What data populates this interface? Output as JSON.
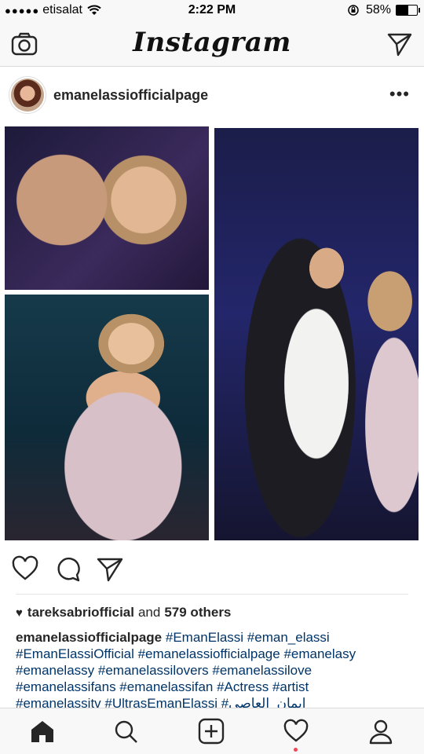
{
  "status": {
    "carrier": "etisalat",
    "time": "2:22 PM",
    "battery": "58%",
    "battery_level": 0.58
  },
  "app": {
    "title": "Instagram"
  },
  "post": {
    "username": "emanelassiofficialpage",
    "likes": {
      "liker": "tareksabriofficial",
      "connector": "and",
      "others": "579 others"
    },
    "caption_user": "emanelassiofficialpage",
    "hashtags_line1": "#EmanElassi  #eman_elassi",
    "hashtags_line2": "#EmanElassiOfficial #emanelassiofficialpage  #emanelasy",
    "hashtags_line3": "#emanelassy #emanelassilovers  #emanelassilove",
    "hashtags_line4": "#emanelassifans  #emanelassifan  #Actress  #artist",
    "hashtags_line5": "#emanelassitv  #UltrasEmanElassi #ايمان_العاصي"
  },
  "icons": {
    "camera": "camera-icon",
    "direct": "paper-plane-icon",
    "more": "more-options-icon",
    "like": "heart-icon",
    "comment": "comment-icon",
    "share": "paper-plane-icon",
    "home": "home-icon",
    "search": "search-icon",
    "add": "add-post-icon",
    "activity": "heart-icon",
    "profile": "profile-icon"
  },
  "colors": {
    "hashtag": "#003569",
    "notification": "#ed4956"
  }
}
